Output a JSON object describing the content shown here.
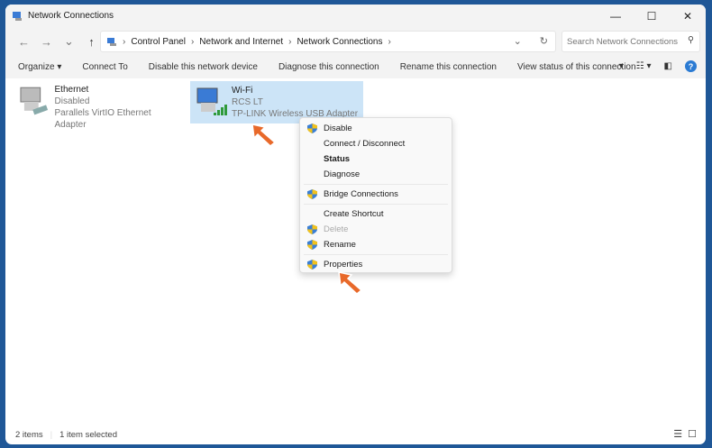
{
  "window": {
    "title": "Network Connections",
    "minimize": "—",
    "maximize": "☐",
    "close": "✕"
  },
  "nav": {
    "back": "←",
    "forward": "→",
    "recent": "⌄",
    "up": "↑"
  },
  "breadcrumb": [
    "Control Panel",
    "Network and Internet",
    "Network Connections"
  ],
  "search": {
    "placeholder": "Search Network Connections"
  },
  "toolbar": {
    "organize": "Organize ▾",
    "connect_to": "Connect To",
    "disable": "Disable this network device",
    "diagnose": "Diagnose this connection",
    "rename": "Rename this connection",
    "view_status": "View status of this connection"
  },
  "items": [
    {
      "name": "Ethernet",
      "status": "Disabled",
      "adapter": "Parallels VirtIO Ethernet Adapter"
    },
    {
      "name": "Wi-Fi",
      "status": "RCS LT",
      "adapter": "TP-LINK Wireless USB Adapter"
    }
  ],
  "context_menu": {
    "disable": "Disable",
    "connect": "Connect / Disconnect",
    "status": "Status",
    "diagnose": "Diagnose",
    "bridge": "Bridge Connections",
    "shortcut": "Create Shortcut",
    "delete": "Delete",
    "rename": "Rename",
    "properties": "Properties"
  },
  "statusbar": {
    "count": "2 items",
    "selected": "1 item selected"
  },
  "colors": {
    "accent": "#2b7bd3",
    "selection": "#cce4f7",
    "arrow": "#e8692a",
    "frame": "#1f5797"
  }
}
